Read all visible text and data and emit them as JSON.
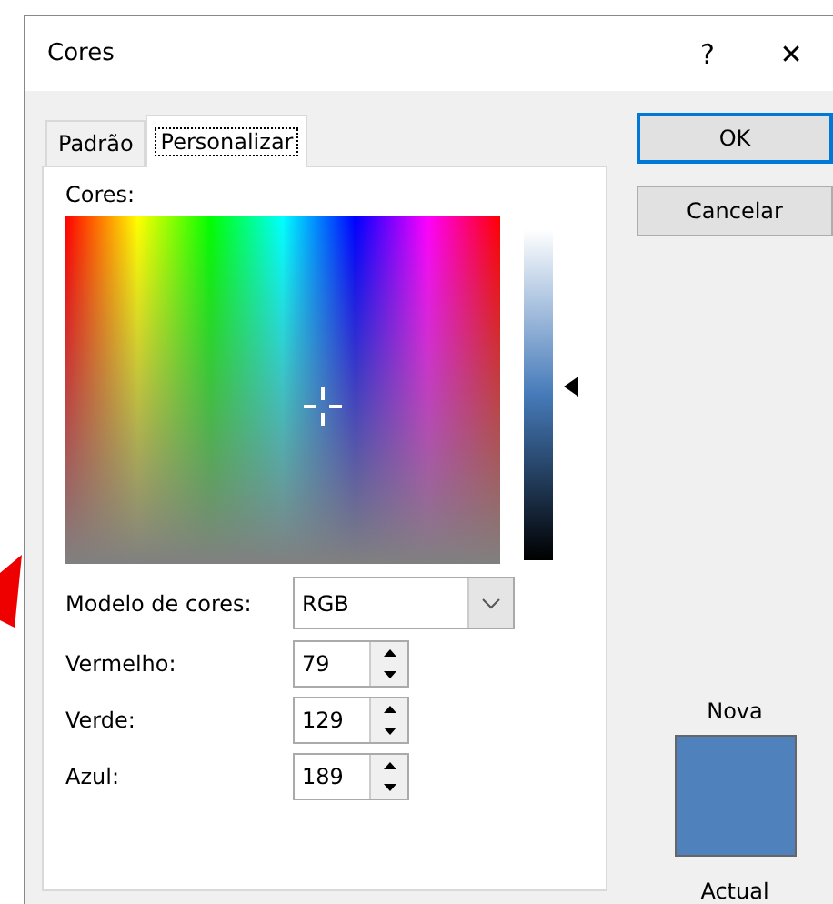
{
  "window": {
    "title": "Cores",
    "help": "?",
    "close": "✕"
  },
  "tabs": [
    {
      "label": "Padrão",
      "selected": false
    },
    {
      "label": "Personalizar",
      "selected": true
    }
  ],
  "colors_label": "Cores:",
  "color_model": {
    "label": "Modelo de cores:",
    "value": "RGB"
  },
  "channels": [
    {
      "label": "Vermelho:",
      "value": "79"
    },
    {
      "label": "Verde:",
      "value": "129"
    },
    {
      "label": "Azul:",
      "value": "189"
    }
  ],
  "buttons": [
    {
      "label": "OK",
      "default": true
    },
    {
      "label": "Cancelar",
      "default": false
    }
  ],
  "preview": {
    "new_label": "Nova",
    "current_label": "Actual"
  }
}
